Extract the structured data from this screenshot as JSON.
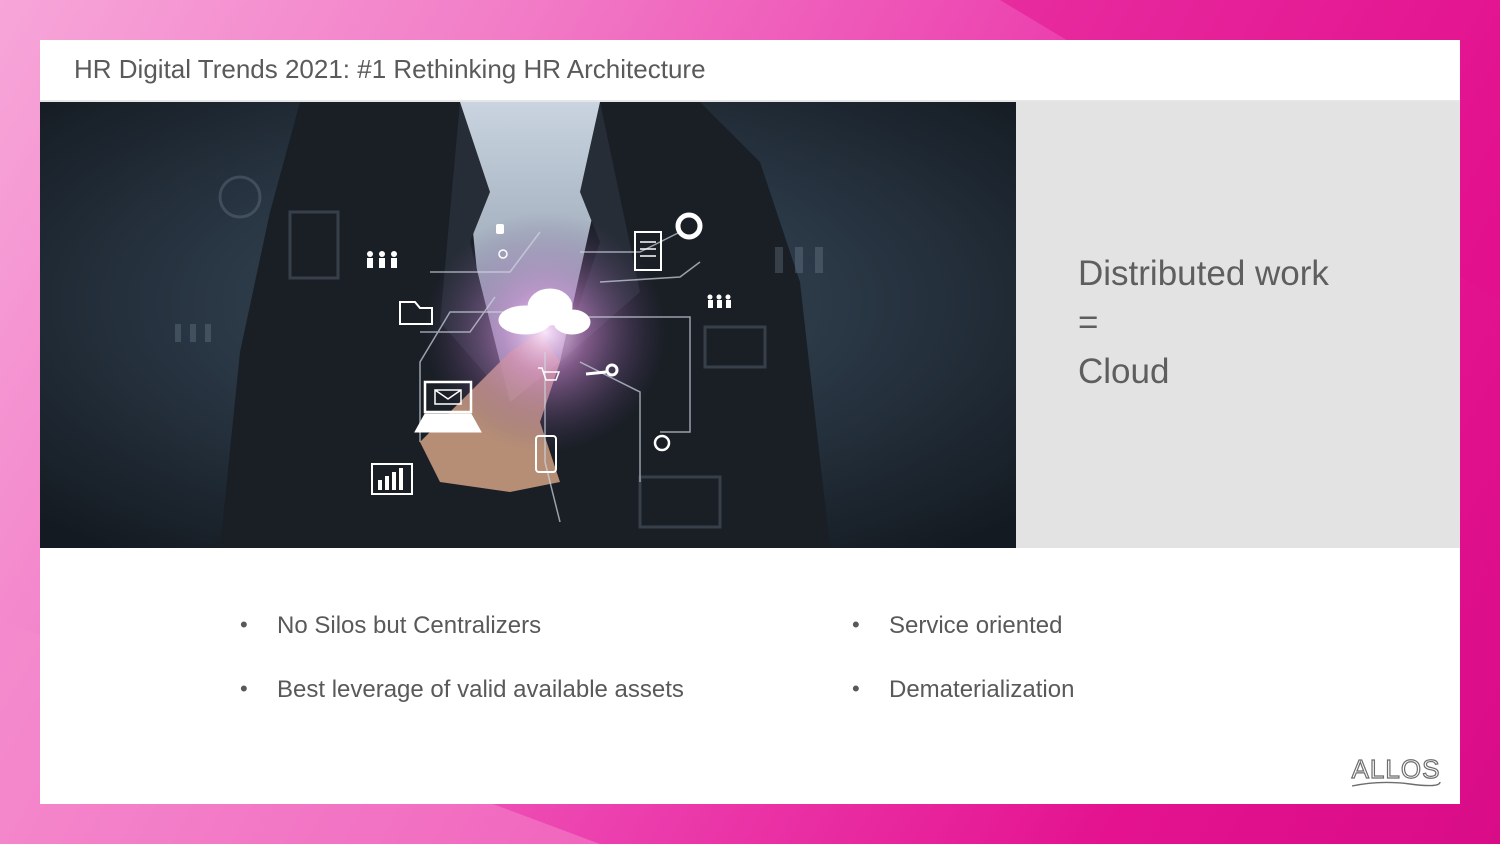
{
  "slide": {
    "title": "HR Digital Trends 2021: #1 Rethinking HR Architecture"
  },
  "side_panel": {
    "lines": [
      "Distributed work",
      "=",
      "Cloud"
    ]
  },
  "bullets": {
    "left": [
      "No Silos but Centralizers",
      "Best leverage of valid available assets"
    ],
    "right": [
      "Service oriented",
      "Dematerialization"
    ],
    "marker": "•"
  },
  "logo": {
    "text": "ALLOS"
  },
  "colors": {
    "background_pink": "#e4128f",
    "panel_gray": "#e3e3e3",
    "text_gray": "#5a5a5a"
  },
  "icons": [
    "people-icon",
    "folder-icon",
    "cloud-icon",
    "document-icon",
    "donut-chart-icon",
    "mail-icon",
    "laptop-icon",
    "key-icon",
    "cart-icon",
    "phone-icon",
    "bar-chart-icon",
    "globe-search-icon"
  ]
}
